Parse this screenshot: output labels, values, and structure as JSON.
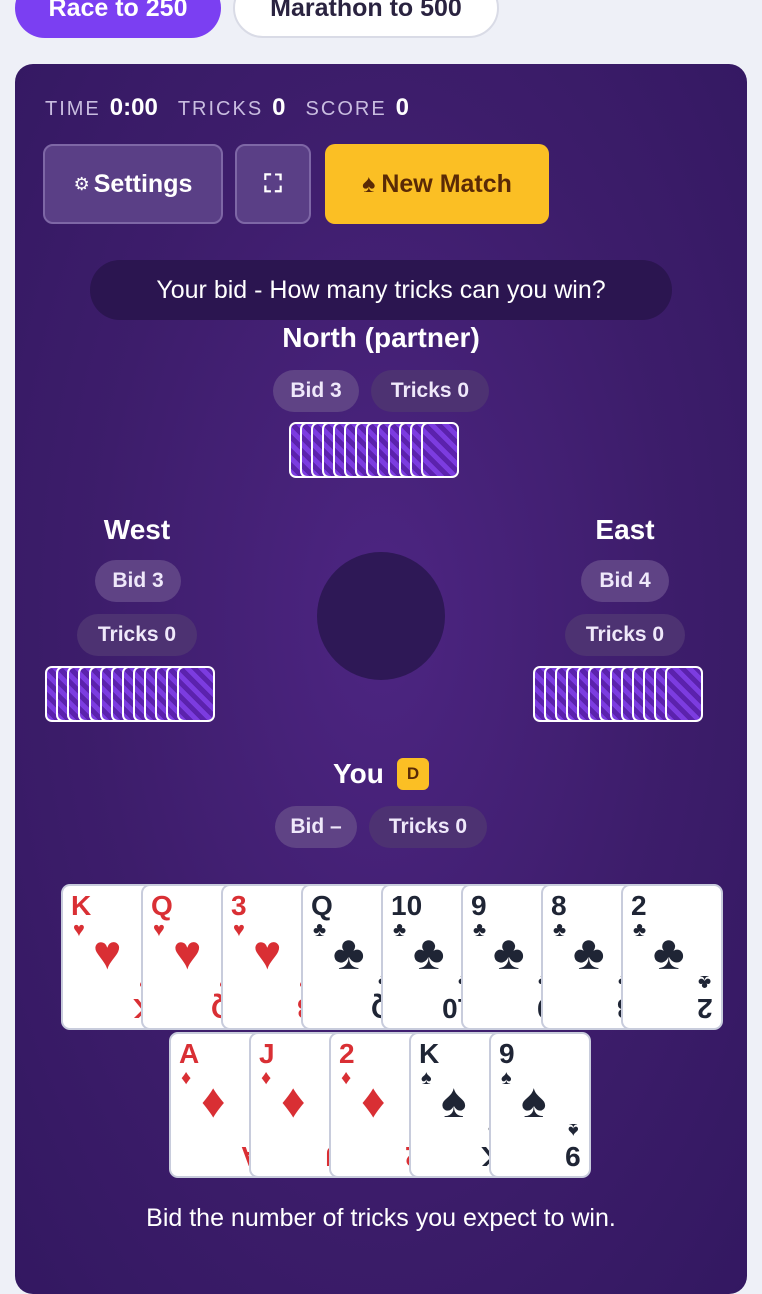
{
  "modes": {
    "race": "Race to 250",
    "marathon": "Marathon to 500"
  },
  "stats": {
    "time_label": "TIME",
    "time_value": "0:00",
    "tricks_label": "TRICKS",
    "tricks_value": "0",
    "score_label": "SCORE",
    "score_value": "0"
  },
  "toolbar": {
    "settings_icon": "⚙",
    "settings_label": "Settings",
    "fullscreen_icon": "⛶",
    "new_match_icon": "♠",
    "new_match_label": "New Match"
  },
  "prompt": "Your bid - How many tricks can you win?",
  "north": {
    "name": "North (partner)",
    "bid": "Bid 3",
    "tricks": "Tricks 0",
    "card_count": 13
  },
  "west": {
    "name": "West",
    "bid": "Bid 3",
    "tricks": "Tricks 0",
    "card_count": 13
  },
  "east": {
    "name": "East",
    "bid": "Bid 4",
    "tricks": "Tricks 0",
    "card_count": 13
  },
  "you": {
    "name": "You",
    "dealer_badge": "D",
    "bid": "Bid –",
    "tricks": "Tricks 0"
  },
  "hand": [
    {
      "rank": "K",
      "suit": "♥",
      "color": "red"
    },
    {
      "rank": "Q",
      "suit": "♥",
      "color": "red"
    },
    {
      "rank": "3",
      "suit": "♥",
      "color": "red"
    },
    {
      "rank": "Q",
      "suit": "♣",
      "color": "black"
    },
    {
      "rank": "10",
      "suit": "♣",
      "color": "black"
    },
    {
      "rank": "9",
      "suit": "♣",
      "color": "black"
    },
    {
      "rank": "8",
      "suit": "♣",
      "color": "black"
    },
    {
      "rank": "2",
      "suit": "♣",
      "color": "black"
    },
    {
      "rank": "A",
      "suit": "♦",
      "color": "red"
    },
    {
      "rank": "J",
      "suit": "♦",
      "color": "red"
    },
    {
      "rank": "2",
      "suit": "♦",
      "color": "red"
    },
    {
      "rank": "K",
      "suit": "♠",
      "color": "black"
    },
    {
      "rank": "9",
      "suit": "♠",
      "color": "black"
    }
  ],
  "footer": "Bid the number of tricks you expect to win."
}
